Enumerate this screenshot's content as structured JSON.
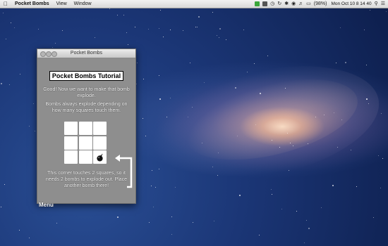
{
  "menubar": {
    "app_name": "Pocket Bombs",
    "items": [
      "View",
      "Window"
    ],
    "battery": "(98%)",
    "clock": "Mon Oct 10   8 14 40"
  },
  "window": {
    "title": "Pocket Bombs"
  },
  "tutorial": {
    "title": "Pocket Bombs Tutorial",
    "paragraph1": "Good! Now we want to make that bomb explode.",
    "paragraph2": "Bombs always explode depending on how many squares touch them.",
    "paragraph3": "This corner touches 2 squares, so it needs 2 bombs to explode out. Place another bomb there!",
    "menu_label": "Menu"
  },
  "board": {
    "rows": 3,
    "cols": 3,
    "bomb_cell": [
      2,
      2
    ]
  },
  "colors": {
    "window_bg": "#8e8e8e",
    "cell": "#ffffff",
    "desktop": "#1b3676"
  }
}
